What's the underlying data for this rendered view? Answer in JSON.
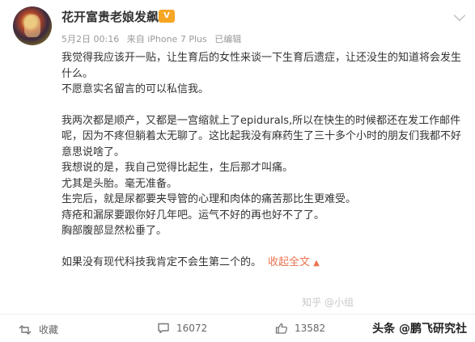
{
  "user": {
    "name": "花开富贵老娘发飙",
    "vip_badge": "V"
  },
  "meta": {
    "time": "5月2日 00:16",
    "source": "来自 iPhone 7 Plus",
    "edited": "已编辑"
  },
  "post": {
    "paragraphs": [
      "我觉得我应该开一贴，让生育后的女性来谈一下生育后遗症，让还没生的知道将会发生什么。",
      "不愿意实名留言的可以私信我。",
      "",
      "我两次都是顺产，又都是一宫缩就上了epidurals,所以在快生的时候都还在发工作邮件呢，因为不疼但躺着太无聊了。这比起我没有麻药生了三十多个小时的朋友们我都不好意思说啥了。",
      "我想说的是，我自己觉得比起生，生后那才叫痛。",
      "尤其是头胎。毫无准备。",
      "生完后，就是尿都要夹导管的心理和肉体的痛苦那比生更难受。",
      "痔疮和漏尿要跟你好几年吧。运气不好的再也好不了了。",
      "胸部腹部显然松垂了。",
      "",
      "如果没有现代科技我肯定不会生第二个的。"
    ],
    "collapse_label": "收起全文",
    "collapse_caret": "▲"
  },
  "actions": {
    "repost_label": "收藏",
    "comment_count": "16072",
    "like_count": "13582"
  },
  "watermark": {
    "faint_text": "知乎 @小组",
    "main_text": "头条 @鹏飞研究社"
  },
  "colors": {
    "accent": "#eb7350",
    "badge": "#f6a623",
    "meta": "#999999"
  }
}
